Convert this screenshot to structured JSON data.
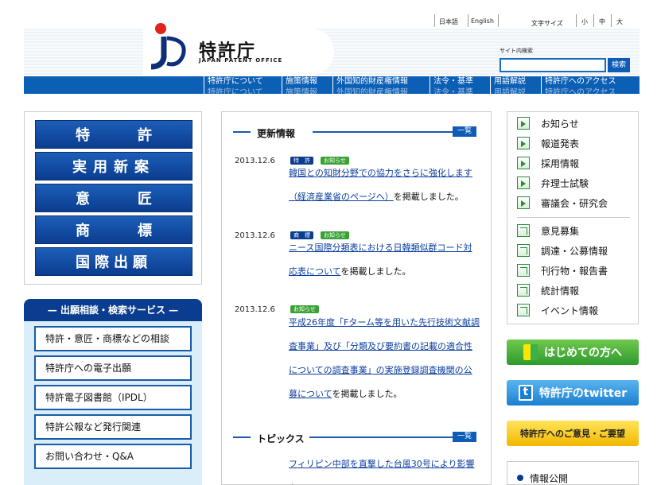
{
  "header": {
    "logo_text": "特許庁",
    "logo_sub": "JAPAN PATENT OFFICE",
    "lang": {
      "ja": "日本語",
      "en": "English"
    },
    "font_size": {
      "label": "文字サイズ",
      "small": "小",
      "medium": "中",
      "large": "大"
    },
    "search": {
      "label": "サイト内検索",
      "button": "検索",
      "value": ""
    }
  },
  "nav": {
    "items": [
      {
        "label": "特許庁について",
        "ghost": "特許庁について"
      },
      {
        "label": "施策情報",
        "ghost": "施策情報"
      },
      {
        "label": "外国知的財産権情報",
        "ghost": "外国知的財産権情報"
      },
      {
        "label": "法令・基準",
        "ghost": "法令・基準"
      },
      {
        "label": "用語解説",
        "ghost": "用語解説"
      },
      {
        "label": "特許庁へのアクセス",
        "ghost": "特許庁へのアクセス"
      }
    ]
  },
  "left": {
    "categories": [
      {
        "c1": "特",
        "c2": "許"
      },
      {
        "c1": "実用新案",
        "c2": ""
      },
      {
        "c1": "意",
        "c2": "匠"
      },
      {
        "c1": "商",
        "c2": "標"
      },
      {
        "c1": "国際出願",
        "c2": ""
      }
    ],
    "service_title": "出願相談・検索サービス",
    "services": [
      "特許・意匠・商標などの相談",
      "特許庁への電子出願",
      "特許電子図書館（IPDL）",
      "特許公報など発行関連",
      "お問い合わせ・Q&A"
    ]
  },
  "center": {
    "updates_title": "更新情報",
    "more": "一覧",
    "news": [
      {
        "date": "2013.12.6",
        "tags": [
          "特　許",
          "お知らせ"
        ],
        "link": "韓国との知財分野での協力をさらに強化します（経済産業省のページへ）",
        "suffix": "を掲載しました。"
      },
      {
        "date": "2013.12.6",
        "tags": [
          "商　標",
          "お知らせ"
        ],
        "link": "ニース国際分類表における日韓類似群コード対応表について",
        "suffix": "を掲載しました。"
      },
      {
        "date": "2013.12.6",
        "tags": [
          "お知らせ"
        ],
        "link": "平成26年度「Fターム等を用いた先行技術文献調査事業」及び「分類及び要約書の記載の適合性についての調査事業」の実施登録調査機関の公募について",
        "suffix": "を掲載しました。"
      }
    ],
    "topics_title": "トピックス",
    "topics_first": "フィリピン中部を直撃した台風30号により影響を"
  },
  "right": {
    "items1": [
      "お知らせ",
      "報道発表",
      "採用情報",
      "弁理士試験",
      "審議会・研究会"
    ],
    "items2": [
      "意見募集",
      "調達・公募情報",
      "刊行物・報告書",
      "統計情報",
      "イベント情報"
    ],
    "banners": {
      "beginner": "はじめての方へ",
      "twitter": "特許庁のtwitter",
      "opinion": "特許庁へのご意見・ご要望"
    },
    "info_disclosure": "情報公開"
  }
}
